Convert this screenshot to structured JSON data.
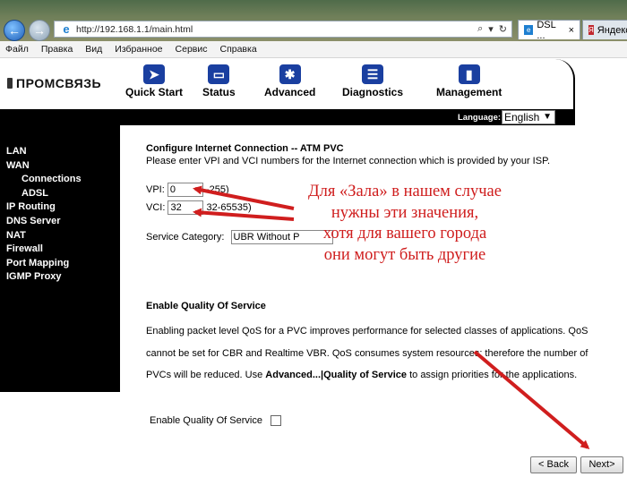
{
  "browser": {
    "url": "http://192.168.1.1/main.html",
    "tabs": [
      {
        "label": "DSL ...",
        "active": true
      },
      {
        "label": "Яндекс",
        "active": false
      }
    ],
    "menu": [
      "Файл",
      "Правка",
      "Вид",
      "Избранное",
      "Сервис",
      "Справка"
    ]
  },
  "router": {
    "logo_text": "ПРОМСВЯЗЬ",
    "nav_tabs": [
      {
        "label": "Quick Start",
        "icon": "quick-start-icon"
      },
      {
        "label": "Status",
        "icon": "status-icon"
      },
      {
        "label": "Advanced",
        "icon": "advanced-icon"
      },
      {
        "label": "Diagnostics",
        "icon": "diagnostics-icon"
      },
      {
        "label": "Management",
        "icon": "management-icon"
      }
    ],
    "language_label": "Language:",
    "language_value": "English",
    "sidebar": [
      "LAN",
      "WAN",
      "Connections",
      "ADSL",
      "IP Routing",
      "DNS Server",
      "NAT",
      "Firewall",
      "Port Mapping",
      "IGMP Proxy"
    ]
  },
  "form": {
    "title": "Configure Internet Connection -- ATM PVC",
    "description": "Please enter VPI and VCI numbers for the Internet connection which is provided by your ISP.",
    "vpi_label": "VPI:",
    "vpi_value": "0",
    "vpi_range": "-255)",
    "vci_label": "VCI:",
    "vci_value": "32",
    "vci_range": "32-65535)",
    "service_category_label": "Service Category:",
    "service_category_value": "UBR Without P",
    "qos_title": "Enable Quality Of Service",
    "qos_text_1": "Enabling packet level QoS for a PVC improves performance for selected classes of applications. QoS cannot be set for CBR and Realtime VBR. QoS consumes system resources; therefore the number of PVCs will be reduced. Use ",
    "qos_link": "Advanced...|Quality of Service",
    "qos_text_2": " to assign priorities for the applications.",
    "qos_checkbox_label": "Enable Quality Of Service",
    "qos_checked": false,
    "back_label": "< Back",
    "next_label": "Next>"
  },
  "annotation": {
    "lines": [
      "Для «Зала» в нашем случае",
      "нужны эти значения,",
      "хотя для вашего города",
      "они могут быть другие"
    ],
    "color": "#cf1d1d"
  },
  "colors": {
    "sidebar_bg": "#000000",
    "icon_blue": "#1a3fa0",
    "annotation_red": "#cf1d1d"
  }
}
